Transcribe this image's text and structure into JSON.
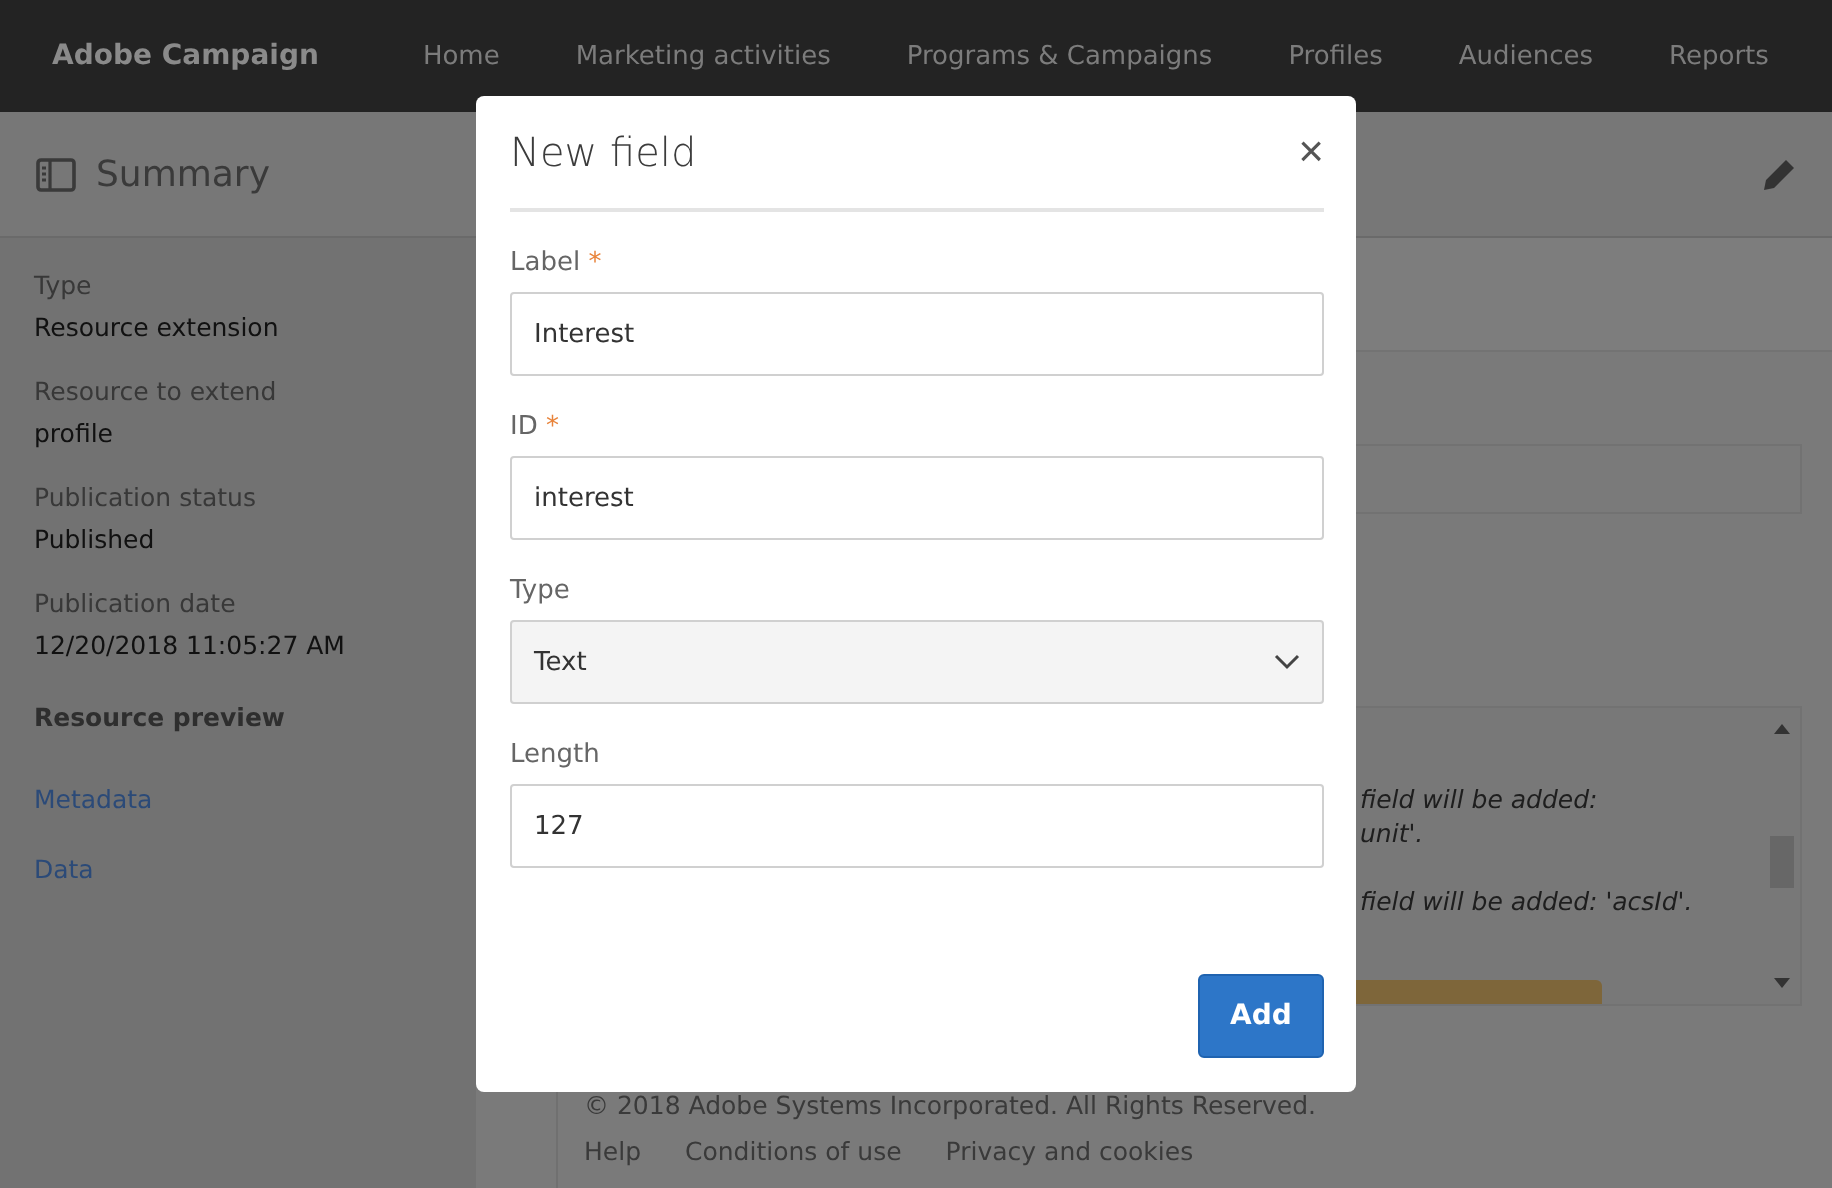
{
  "app": {
    "name": "Adobe Campaign",
    "nav": [
      "Home",
      "Marketing activities",
      "Programs & Campaigns",
      "Profiles",
      "Audiences",
      "Reports"
    ]
  },
  "sidebar": {
    "title": "Summary",
    "fields": [
      {
        "label": "Type",
        "value": "Resource extension"
      },
      {
        "label": "Resource to extend",
        "value": "profile"
      },
      {
        "label": "Publication status",
        "value": "Published"
      },
      {
        "label": "Publication date",
        "value": "12/20/2018 11:05:27 AM"
      }
    ],
    "section_title": "Resource preview",
    "links": [
      "Metadata",
      "Data"
    ]
  },
  "log": {
    "lines": [
      {
        "text": "field will be added:",
        "paragraph_start": false
      },
      {
        "text": "unit'.",
        "paragraph_start": false
      },
      {
        "text": "field will be added: 'acsId'.",
        "paragraph_start": true
      }
    ],
    "progress": {
      "level": 0.84
    }
  },
  "footer": {
    "copyright": "© 2018 Adobe Systems Incorporated. All Rights Reserved.",
    "links": [
      "Help",
      "Conditions of use",
      "Privacy and cookies"
    ]
  },
  "dialog": {
    "title": "New field",
    "close": "×",
    "required_mark": "*",
    "fields": [
      {
        "kind": "text",
        "label": "Label",
        "required": true,
        "value": "Interest"
      },
      {
        "kind": "text",
        "label": "ID",
        "required": true,
        "value": "interest"
      },
      {
        "kind": "select",
        "label": "Type",
        "required": false,
        "value": "Text"
      },
      {
        "kind": "text",
        "label": "Length",
        "required": false,
        "value": "127"
      }
    ],
    "button": "Add"
  }
}
